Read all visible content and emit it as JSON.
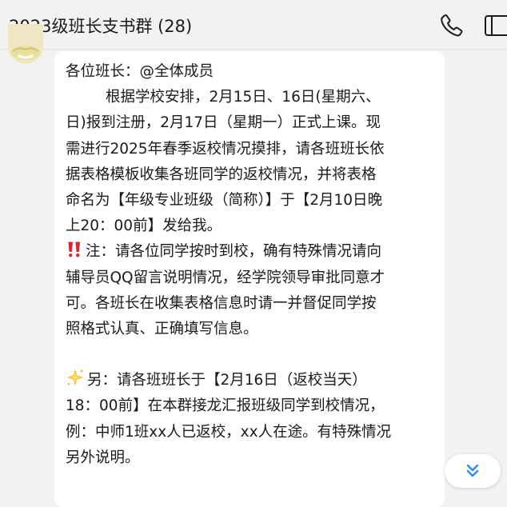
{
  "header": {
    "title": "2023级班长支书群 (28)",
    "call_icon": "phone-icon",
    "more_icon": "group-panel-icon"
  },
  "message": {
    "avatar_icon": "sender-avatar",
    "lines": [
      "各位班长：@全体成员",
      "根据学校安排，2月15日、16日(星期六、",
      "日)报到注册，2月17日（星期一）正式上课。现",
      "需进行2025年春季返校情况摸排，请各班班长依",
      "据表格模板收集各班同学的返校情况，并将表格",
      "命名为【年级专业班级（简称）】于【2月10日晚",
      "上20：00前】发给我。",
      "注：请各位同学按时到校，确有特殊情况请向",
      "辅导员QQ留言说明情况，经学院领导审批同意才",
      "可。各班长在收集表格信息时请一并督促同学按",
      "照格式认真、正确填写信息。",
      "另：请各班班长于【2月16日（返校当天）",
      "18：00前】在本群接龙汇报班级同学到校情况，",
      "例：中师1班xx人已返校，xx人在途。有特殊情况",
      "另外说明。"
    ],
    "exclamation_icon": "double-exclamation-icon",
    "sparkle_icon": "glowing-star-icon"
  },
  "scroll": {
    "icon": "double-chevron-down-icon"
  },
  "colors": {
    "background": "#f2f2f2",
    "bubble": "#ffffff",
    "text": "#1a1a1a",
    "exclamation": "#e0242a",
    "sparkle": "#f5c33b",
    "scroll_chevron": "#2a8cf0"
  }
}
